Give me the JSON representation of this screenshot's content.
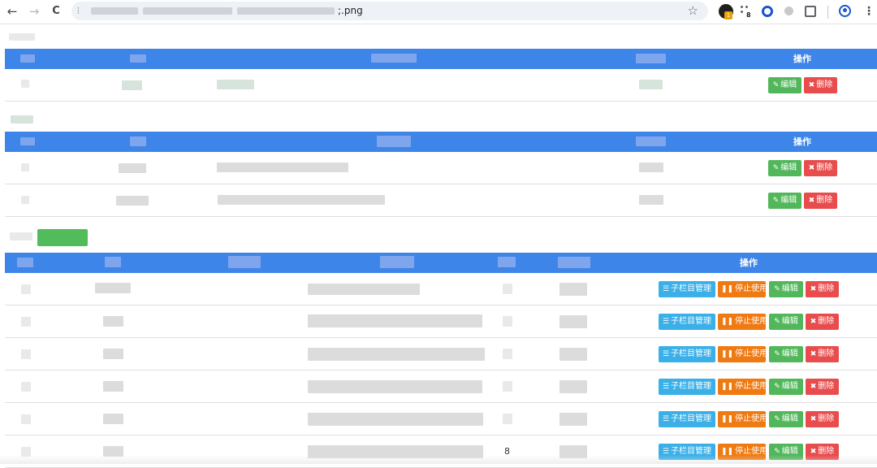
{
  "browser": {
    "back_icon": "←",
    "forward_icon": "→",
    "reload_icon": "C",
    "url_suffix": ";.png",
    "bookmark_icon": "☆",
    "ext1_badge": "1",
    "ext2_badge": "8",
    "menu_icon": "⋮"
  },
  "colors": {
    "header_blue": "#3e85e9",
    "edit_green": "#52b75a",
    "delete_red": "#e84c4c",
    "sub_blue": "#3bb0e8",
    "stop_orange": "#f07a12"
  },
  "labels": {
    "op_header": "操作",
    "edit": "编辑",
    "delete": "删除",
    "sub_manage": "子栏目管理",
    "stop_use": "停止使用",
    "edit_icon": "✎",
    "delete_icon": "✖",
    "list_icon": "☰",
    "pause_icon": "❚❚"
  },
  "table3": {
    "last_row_number": "8"
  }
}
